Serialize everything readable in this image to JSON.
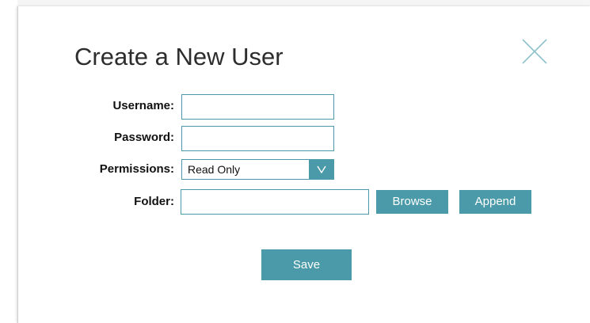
{
  "dialog": {
    "title": "Create a New User",
    "close_icon": "close-icon"
  },
  "form": {
    "username": {
      "label": "Username:",
      "value": "",
      "placeholder": ""
    },
    "password": {
      "label": "Password:",
      "value": "",
      "placeholder": ""
    },
    "permissions": {
      "label": "Permissions:",
      "selected": "Read Only",
      "arrow_glyph": "v",
      "arrow_icon": "chevron-down-icon"
    },
    "folder": {
      "label": "Folder:",
      "value": "",
      "placeholder": ""
    }
  },
  "buttons": {
    "browse": "Browse",
    "append": "Append",
    "save": "Save"
  },
  "colors": {
    "accent": "#4a9aa9",
    "title_text": "#2d2d2d",
    "label_text": "#111111",
    "close_icon": "#8fc3cc"
  }
}
